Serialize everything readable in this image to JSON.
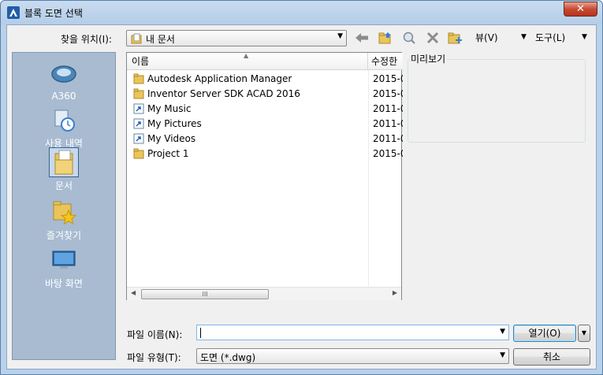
{
  "window": {
    "title": "블록 도면 선택",
    "close_glyph": "✕"
  },
  "toolbar": {
    "look_in_label": "찾을 위치(I):",
    "look_in_value": "내 문서",
    "views_label": "뷰(V)",
    "tools_label": "도구(L)"
  },
  "places": [
    {
      "label": "A360",
      "icon": "a360-icon"
    },
    {
      "label": "사용 내역",
      "icon": "history-icon"
    },
    {
      "label": "문서",
      "icon": "documents-icon",
      "selected": true
    },
    {
      "label": "즐겨찾기",
      "icon": "favorites-icon"
    },
    {
      "label": "바탕 화면",
      "icon": "desktop-icon"
    }
  ],
  "file_list": {
    "columns": {
      "name": "이름",
      "date": "수정한"
    },
    "rows": [
      {
        "name": "Autodesk Application Manager",
        "date": "2015-0",
        "type": "folder"
      },
      {
        "name": "Inventor Server SDK ACAD 2016",
        "date": "2015-0",
        "type": "folder"
      },
      {
        "name": "My Music",
        "date": "2011-0",
        "type": "shortcut"
      },
      {
        "name": "My Pictures",
        "date": "2011-0",
        "type": "shortcut"
      },
      {
        "name": "My Videos",
        "date": "2011-0",
        "type": "shortcut"
      },
      {
        "name": "Project 1",
        "date": "2015-0",
        "type": "folder"
      }
    ],
    "scroll_thumb_glyph": "III"
  },
  "preview": {
    "label": "미리보기"
  },
  "bottom": {
    "file_name_label": "파일 이름(N):",
    "file_name_value": "",
    "file_type_label": "파일 유형(T):",
    "file_type_value": "도면 (*.dwg)",
    "open_label": "열기(O)",
    "cancel_label": "취소"
  },
  "colors": {
    "accent": "#3c7fb1",
    "places_bg": "#a8bbd1",
    "title_bg": "#b9d1ea"
  }
}
